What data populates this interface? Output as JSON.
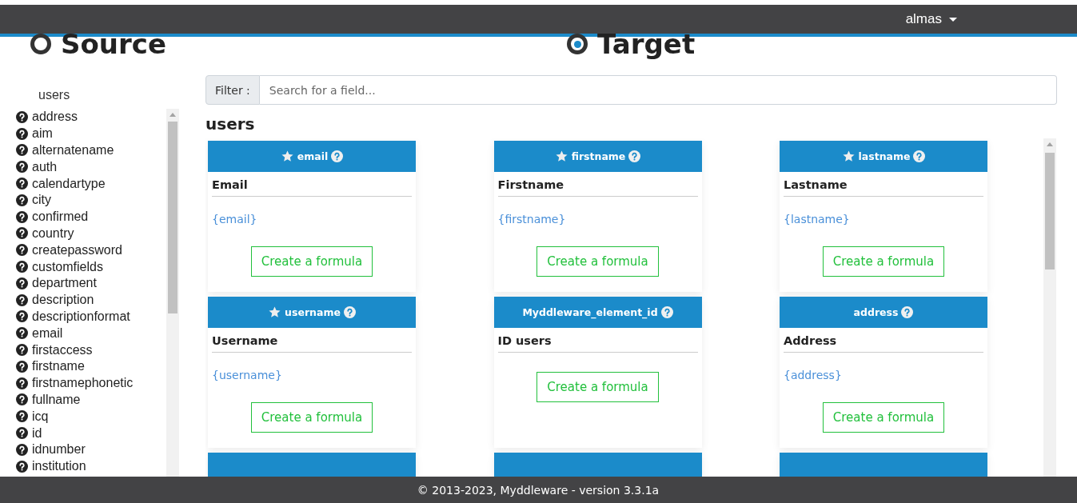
{
  "navbar": {
    "user": "almas"
  },
  "modes": [
    {
      "label": "Source",
      "selected": false
    },
    {
      "label": "Target",
      "selected": true
    }
  ],
  "source": {
    "module": "users",
    "fields": [
      "address",
      "aim",
      "alternatename",
      "auth",
      "calendartype",
      "city",
      "confirmed",
      "country",
      "createpassword",
      "customfields",
      "department",
      "description",
      "descriptionformat",
      "email",
      "firstaccess",
      "firstname",
      "firstnamephonetic",
      "fullname",
      "icq",
      "id",
      "idnumber",
      "institution"
    ]
  },
  "filter": {
    "label": "Filter :",
    "placeholder": "Search for a field..."
  },
  "target": {
    "module": "users",
    "cards": [
      {
        "kind": "field",
        "title": "email",
        "starred": true,
        "label": "Email",
        "value": "{email}",
        "button": "Create a formula"
      },
      {
        "kind": "field",
        "title": "firstname",
        "starred": true,
        "label": "Firstname",
        "value": "{firstname}",
        "button": "Create a formula"
      },
      {
        "kind": "field",
        "title": "lastname",
        "starred": true,
        "label": "Lastname",
        "value": "{lastname}",
        "button": "Create a formula"
      },
      {
        "kind": "field",
        "title": "username",
        "starred": true,
        "label": "Username",
        "value": "{username}",
        "button": "Create a formula"
      },
      {
        "kind": "field",
        "title": "Myddleware_element_id",
        "starred": false,
        "label": "ID users",
        "button": "Create a formula"
      },
      {
        "kind": "field",
        "title": "address",
        "starred": false,
        "label": "Address",
        "value": "{address}",
        "button": "Create a formula"
      },
      {
        "kind": "hidden"
      },
      {
        "kind": "hidden"
      },
      {
        "kind": "hidden"
      }
    ]
  },
  "footer": "© 2013-2023, Myddleware - version 3.3.1a"
}
